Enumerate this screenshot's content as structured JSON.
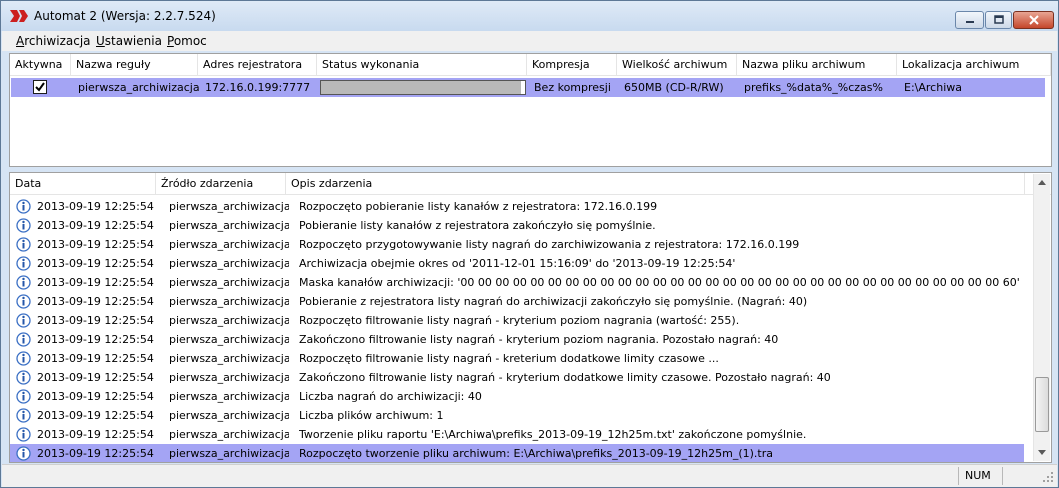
{
  "window": {
    "title": "Automat 2 (Wersja: 2.2.7.524)"
  },
  "menu": [
    {
      "label": "Archiwizacja",
      "key": "A",
      "rest": "rchiwizacja"
    },
    {
      "label": "Ustawienia",
      "key": "U",
      "rest": "stawienia"
    },
    {
      "label": "Pomoc",
      "key": "P",
      "rest": "omoc"
    }
  ],
  "rules": {
    "columns": [
      "Aktywna",
      "Nazwa reguły",
      "Adres rejestratora",
      "Status wykonania",
      "Kompresja",
      "Wielkość archiwum",
      "Nazwa pliku archiwum",
      "Lokalizacja archiwum"
    ],
    "row": {
      "active": true,
      "name": "pierwsza_archiwizacja",
      "address": "172.16.0.199:7777",
      "progress_fraction": 0.98,
      "compression": "Bez kompresji",
      "size": "650MB (CD-R/RW)",
      "filename": "prefiks_%data%_%czas%",
      "location": "E:\\Archiwa"
    }
  },
  "events": {
    "columns": [
      "Data",
      "Źródło zdarzenia",
      "Opis zdarzenia"
    ],
    "rows": [
      {
        "date": "2013-09-19 12:25:54",
        "source": "pierwsza_archiwizacja",
        "desc": "Rozpoczęto pobieranie listy kanałów z rejestratora: 172.16.0.199"
      },
      {
        "date": "2013-09-19 12:25:54",
        "source": "pierwsza_archiwizacja",
        "desc": "Pobieranie listy kanałów z rejestratora zakończyło się pomyślnie."
      },
      {
        "date": "2013-09-19 12:25:54",
        "source": "pierwsza_archiwizacja",
        "desc": "Rozpoczęto przygotowywanie listy nagrań do zarchiwizowania z rejestratora: 172.16.0.199"
      },
      {
        "date": "2013-09-19 12:25:54",
        "source": "pierwsza_archiwizacja",
        "desc": "Archiwizacja obejmie okres od '2011-12-01 15:16:09' do '2013-09-19 12:25:54'"
      },
      {
        "date": "2013-09-19 12:25:54",
        "source": "pierwsza_archiwizacja",
        "desc": "Maska kanałów archiwizacji: '00 00 00 00 00 00 00 00 00 00 00 00 00 00 00 00 00 00 00 00 00 00 00 00 00 00 00 00 00 00 00 60'"
      },
      {
        "date": "2013-09-19 12:25:54",
        "source": "pierwsza_archiwizacja",
        "desc": "Pobieranie z rejestratora listy nagrań do archiwizacji zakończyło się pomyślnie. (Nagrań: 40)"
      },
      {
        "date": "2013-09-19 12:25:54",
        "source": "pierwsza_archiwizacja",
        "desc": "Rozpoczęto filtrowanie listy nagrań - kryterium poziom nagrania (wartość: 255)."
      },
      {
        "date": "2013-09-19 12:25:54",
        "source": "pierwsza_archiwizacja",
        "desc": "Zakończono filtrowanie listy nagrań - kryterium poziom nagrania. Pozostało nagrań: 40"
      },
      {
        "date": "2013-09-19 12:25:54",
        "source": "pierwsza_archiwizacja",
        "desc": "Rozpoczęto filtrowanie listy nagrań - kreterium dodatkowe limity czasowe ..."
      },
      {
        "date": "2013-09-19 12:25:54",
        "source": "pierwsza_archiwizacja",
        "desc": "Zakończono filtrowanie listy nagrań - kryterium dodatkowe limity czasowe. Pozostało nagrań: 40"
      },
      {
        "date": "2013-09-19 12:25:54",
        "source": "pierwsza_archiwizacja",
        "desc": "Liczba nagrań do archiwizacji: 40"
      },
      {
        "date": "2013-09-19 12:25:54",
        "source": "pierwsza_archiwizacja",
        "desc": "Liczba plików archiwum: 1"
      },
      {
        "date": "2013-09-19 12:25:54",
        "source": "pierwsza_archiwizacja",
        "desc": "Tworzenie pliku raportu 'E:\\Archiwa\\prefiks_2013-09-19_12h25m.txt' zakończone pomyślnie."
      },
      {
        "date": "2013-09-19 12:25:54",
        "source": "pierwsza_archiwizacja",
        "desc": "Rozpoczęto tworzenie pliku archiwum: E:\\Archiwa\\prefiks_2013-09-19_12h25m_(1).tra",
        "selected": true
      }
    ]
  },
  "statusbar": {
    "num": "NUM"
  },
  "colors": {
    "selection": "#a4a4f4",
    "window_frame": "#d6e4f4",
    "close_button": "#c5462b",
    "app_logo": "#cc1f1f"
  },
  "icons": {
    "app": "dk-logo-icon",
    "event": "info-icon"
  }
}
